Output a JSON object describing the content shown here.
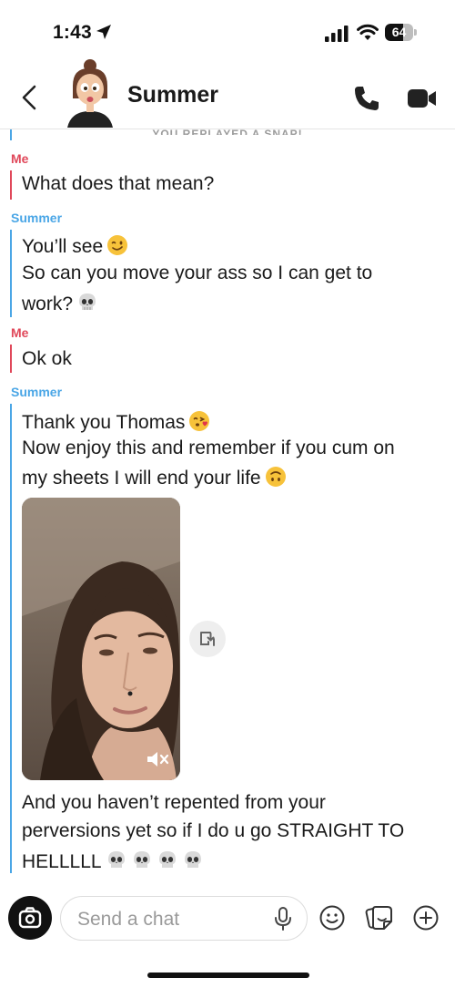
{
  "status_bar": {
    "time": "1:43",
    "battery": "64",
    "battery_level": 0.64,
    "icons": [
      "location-arrow-icon",
      "cellular-signal-icon",
      "wifi-icon",
      "battery-icon"
    ]
  },
  "header": {
    "contact_name": "Summer",
    "icons": [
      "chevron-left-icon",
      "bitmoji-avatar",
      "phone-icon",
      "video-camera-icon"
    ]
  },
  "chat": {
    "replay_notice": "YOU REPLAYED A SNAP!",
    "messages": [
      {
        "sender": "Me",
        "lines": [
          "What does that mean?"
        ]
      },
      {
        "sender": "Summer",
        "lines": [
          "You’ll see",
          "So can you move your ass so I can get to",
          "work?"
        ],
        "emojis": [
          "winking-face",
          "skull"
        ]
      },
      {
        "sender": "Me",
        "lines": [
          "Ok ok"
        ]
      },
      {
        "sender": "Summer",
        "lines": [
          "Thank you Thomas",
          "Now enjoy this and remember if you cum on",
          "my sheets I will end your life"
        ],
        "emojis": [
          "face-blowing-kiss",
          "upside-down-face"
        ]
      },
      {
        "sender": "Summer",
        "media": "video-snap",
        "media_muted": true
      },
      {
        "sender": "Summer",
        "lines": [
          "And you haven’t repented from your",
          "perversions yet so if I do u go STRAIGHT TO",
          "HELLLLL"
        ],
        "emojis": [
          "skull",
          "skull",
          "skull",
          "skull"
        ]
      }
    ]
  },
  "composer": {
    "placeholder": "Send a chat",
    "icons": [
      "camera-icon",
      "microphone-icon",
      "smiley-icon",
      "sticker-icon",
      "plus-icon"
    ]
  }
}
